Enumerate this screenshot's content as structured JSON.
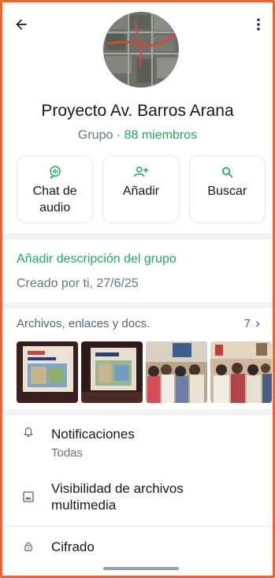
{
  "topbar": {
    "back_icon": "arrow-left-icon",
    "menu_icon": "more-vertical-icon"
  },
  "group": {
    "name": "Proyecto Av. Barros Arana",
    "type": "Grupo",
    "separator": " · ",
    "members": "88 miembros"
  },
  "actions": [
    {
      "label": "Chat de audio",
      "icon": "audio-chat-icon"
    },
    {
      "label": "Añadir",
      "icon": "add-person-icon"
    },
    {
      "label": "Buscar",
      "icon": "search-icon"
    }
  ],
  "description": {
    "add_label": "Añadir descripción del grupo",
    "created": "Creado por ti, 27/6/25"
  },
  "files": {
    "title": "Archivos, enlaces y docs.",
    "count": "7"
  },
  "settings": [
    {
      "title": "Notificaciones",
      "subtitle": "Todas",
      "icon": "bell-icon"
    },
    {
      "title": "Visibilidad de archivos multimedia",
      "icon": "image-icon"
    },
    {
      "title": "Cifrado",
      "icon": "lock-icon"
    }
  ],
  "colors": {
    "accent": "#1daa61",
    "frame": "#f2622a",
    "muted": "#667781"
  }
}
